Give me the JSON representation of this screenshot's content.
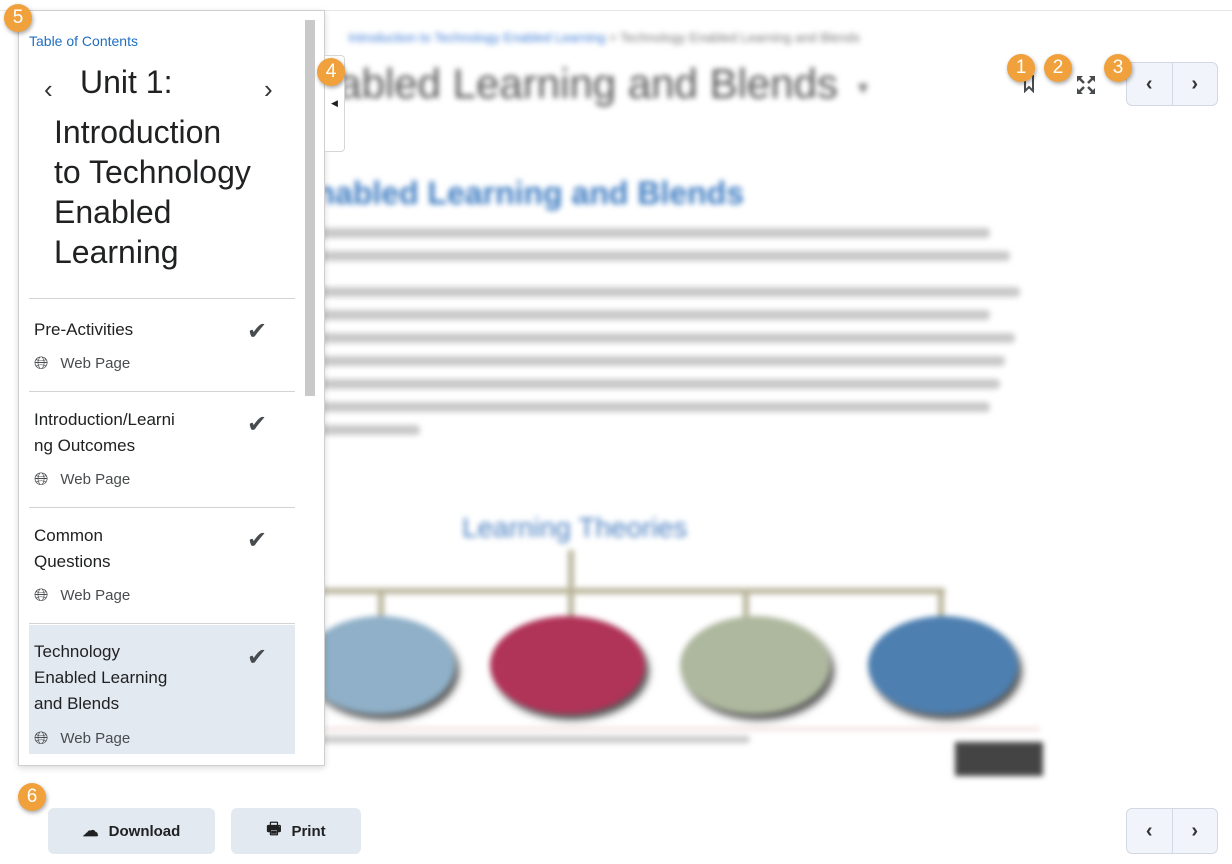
{
  "content": {
    "breadcrumb_link": "Introduction to Technology Enabled Learning",
    "breadcrumb_current": "Technology Enabled Learning and Blends",
    "page_title": "Technology Enabled Learning and Blends",
    "heading": "Technology Enabled Learning and Blends",
    "diagram_title": "Learning Theories",
    "nodes": [
      {
        "color": "#8fb0c8"
      },
      {
        "color": "#b03358"
      },
      {
        "color": "#aeb89e"
      },
      {
        "color": "#4d7fb0"
      }
    ]
  },
  "toc": {
    "label": "Table of Contents",
    "unit_line1": "Unit 1:",
    "unit_lines": [
      "Introduction",
      "to Technology",
      "Enabled",
      "Learning"
    ],
    "items": [
      {
        "lines": [
          "Pre-Activities"
        ],
        "type": "Web Page",
        "completed": true,
        "selected": false
      },
      {
        "lines": [
          "Introduction/Learni",
          "ng Outcomes"
        ],
        "type": "Web Page",
        "completed": true,
        "selected": false
      },
      {
        "lines": [
          "Common",
          "Questions"
        ],
        "type": "Web Page",
        "completed": true,
        "selected": false
      },
      {
        "lines": [
          "Technology",
          "Enabled Learning",
          "and Blends"
        ],
        "type": "Web Page",
        "completed": true,
        "selected": true
      }
    ]
  },
  "toolbar": {
    "prev": "‹",
    "next": "›"
  },
  "footer": {
    "download_label": "Download",
    "print_label": "Print"
  },
  "badges": [
    "1",
    "2",
    "3",
    "4",
    "5",
    "6"
  ],
  "colors": {
    "accent": "#1f6fc2",
    "badge": "#f0a13c",
    "selected": "#e3e9f1"
  }
}
